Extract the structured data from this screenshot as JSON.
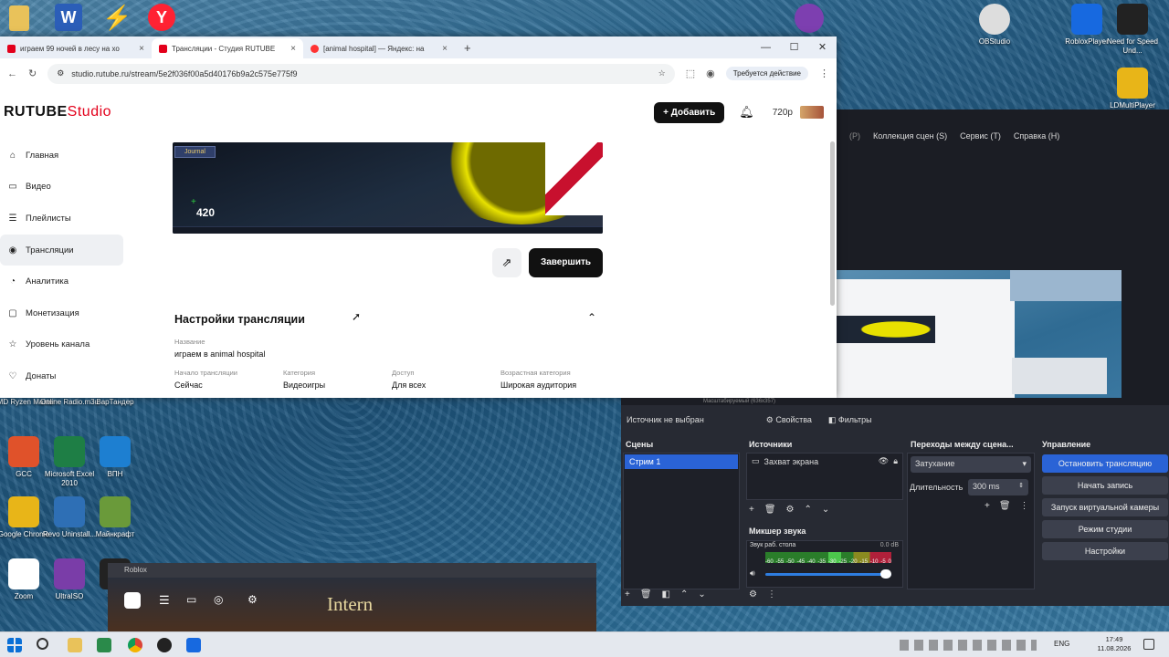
{
  "browser": {
    "tabs": [
      {
        "title": "играем 99 ночей в лесу на хо",
        "active": false
      },
      {
        "title": "Трансляции - Студия RUTUBE",
        "active": true
      },
      {
        "title": "[animal hospital] — Яндекс: на",
        "active": false
      }
    ],
    "new_tab": "+",
    "url": "studio.rutube.ru/stream/5e2f036f00a5d40176b9a2c575e775f9",
    "action_required": "Требуется действие"
  },
  "rutube": {
    "logo_main": "RUTUBE",
    "logo_studio": "Studio",
    "add_button": "Добавить",
    "quality": "720p",
    "sidebar": [
      {
        "label": "Главная",
        "icon": "home-icon",
        "active": false
      },
      {
        "label": "Видео",
        "icon": "video-icon",
        "active": false
      },
      {
        "label": "Плейлисты",
        "icon": "playlist-icon",
        "active": false
      },
      {
        "label": "Трансляции",
        "icon": "broadcast-icon",
        "active": true
      },
      {
        "label": "Аналитика",
        "icon": "analytics-icon",
        "active": false
      },
      {
        "label": "Монетизация",
        "icon": "money-icon",
        "active": false
      },
      {
        "label": "Уровень канала",
        "icon": "star-icon",
        "active": false
      },
      {
        "label": "Донаты",
        "icon": "donate-icon",
        "active": false
      }
    ],
    "preview": {
      "journal": "Journal",
      "counter": "420"
    },
    "end_button": "Завершить",
    "settings": {
      "title": "Настройки трансляции",
      "name_label": "Название",
      "name_value": "играем в animal hospital",
      "fields": [
        {
          "label": "Начало трансляции",
          "value": "Сейчас"
        },
        {
          "label": "Категория",
          "value": "Видеоигры"
        },
        {
          "label": "Доступ",
          "value": "Для всех"
        },
        {
          "label": "Возрастная категория",
          "value": "Широкая аудитория"
        }
      ]
    }
  },
  "desktop": {
    "icons_left": [
      {
        "label": "AMD Ryzen Master",
        "color": "#c0392b"
      },
      {
        "label": "Online Radio.m3u",
        "color": "#2c3e50"
      },
      {
        "label": "ВарТандер",
        "color": "#34495e"
      },
      {
        "label": "GCC",
        "color": "#e0522a"
      },
      {
        "label": "Microsoft Excel 2010",
        "color": "#1e7e45"
      },
      {
        "label": "ВПН",
        "color": "#1d7fd1"
      },
      {
        "label": "Google Chrome",
        "color": "#e8b518"
      },
      {
        "label": "Revo Uninstall...",
        "color": "#2e6fb5"
      },
      {
        "label": "Майнкрафт",
        "color": "#6a9a3a"
      },
      {
        "label": "Zoom",
        "color": "#ffffff"
      },
      {
        "label": "UltraISO",
        "color": "#7a3da8"
      },
      {
        "label": "OBS",
        "color": "#222222"
      }
    ],
    "icons_right": [
      {
        "label": "OBStudio"
      },
      {
        "label": "RobloxPlayer"
      },
      {
        "label": "Need for Speed Und..."
      },
      {
        "label": "LDMultiPlayer"
      }
    ]
  },
  "obs": {
    "menu": [
      "Коллекция сцен (S)",
      "Сервис (T)",
      "Справка (H)"
    ],
    "menu_prefix": "(P)",
    "status_bar": "Масштабируемый (636x357)",
    "no_source": "Источник не выбран",
    "properties": "Свойства",
    "filters": "Фильтры",
    "scenes_title": "Сцены",
    "scenes": [
      "Стрим 1"
    ],
    "sources_title": "Источники",
    "sources": [
      "Захват экрана"
    ],
    "mixer_title": "Микшер звука",
    "mixer_track": "Звук раб. стола",
    "mixer_db": "0.0 dB",
    "mixer_ticks": [
      "-60",
      "-55",
      "-50",
      "-45",
      "-40",
      "-35",
      "-30",
      "-25",
      "-20",
      "-15",
      "-10",
      "-5",
      "0"
    ],
    "transitions_title": "Переходы между сцена...",
    "transition": "Затухание",
    "duration_label": "Длительность",
    "duration_value": "300 ms",
    "controls_title": "Управление",
    "controls": [
      "Остановить трансляцию",
      "Начать запись",
      "Запуск виртуальной камеры",
      "Режим студии",
      "Настройки"
    ]
  },
  "roblox": {
    "title": "Roblox",
    "game_text": "Intern"
  },
  "taskbar": {
    "lang": "ENG",
    "time": "17:49",
    "date": "11.08.2026"
  }
}
